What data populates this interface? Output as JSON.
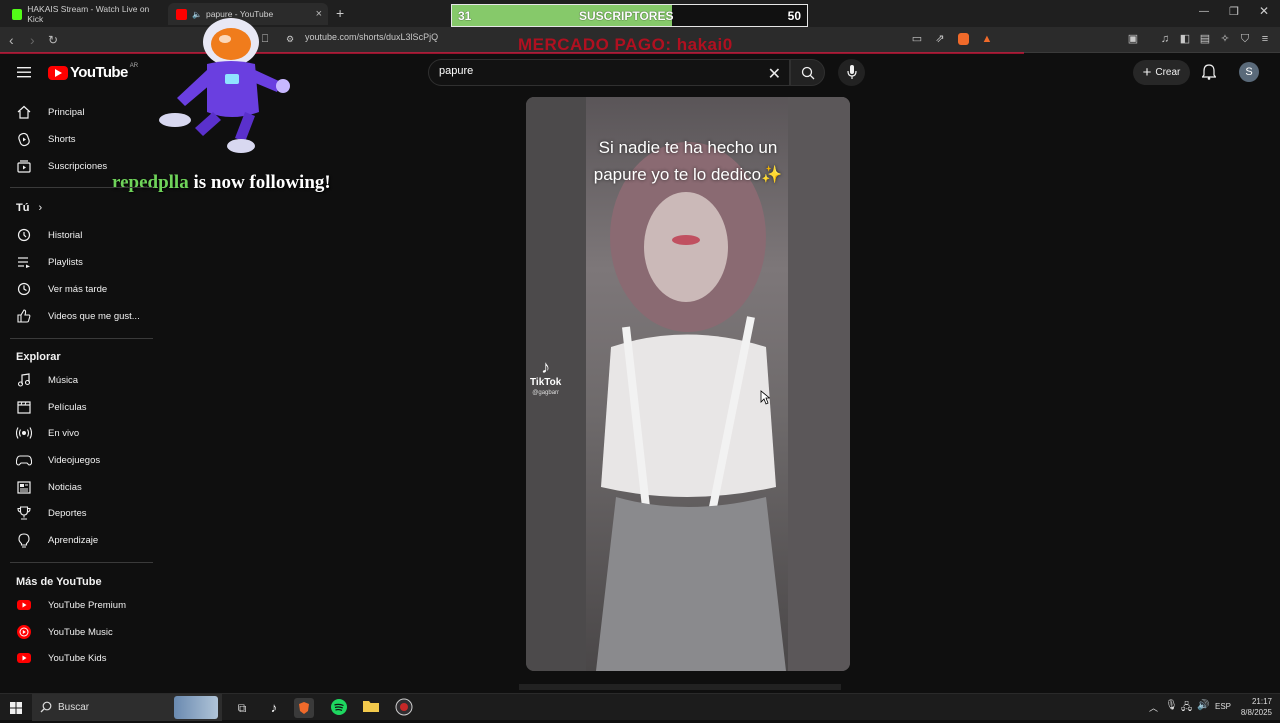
{
  "browser": {
    "tabs": [
      {
        "title": "HAKAIS Stream - Watch Live on Kick"
      },
      {
        "title": "papure - YouTube"
      }
    ],
    "url": "youtube.com/shorts/duxL3lScPjQ"
  },
  "overlay": {
    "sub_current": "31",
    "sub_label": "SUSCRIPTORES",
    "sub_goal": "50",
    "sub_progress": 0.62,
    "mercado": "MERCADO PAGO: hakai0",
    "follower_user": "repedplla",
    "follower_text": " is now following!"
  },
  "youtube": {
    "logo_text": "YouTube",
    "country_code": "AR",
    "search_value": "papure",
    "create_label": "Crear",
    "avatar_letter": "S",
    "sidebar": {
      "main": [
        "Principal",
        "Shorts",
        "Suscripciones"
      ],
      "you_heading": "Tú",
      "you_items": [
        "Historial",
        "Playlists",
        "Ver más tarde",
        "Videos que me gust..."
      ],
      "explore_heading": "Explorar",
      "explore_items": [
        "Música",
        "Películas",
        "En vivo",
        "Videojuegos",
        "Noticias",
        "Deportes",
        "Aprendizaje"
      ],
      "more_heading": "Más de YouTube",
      "more_items": [
        "YouTube Premium",
        "YouTube Music",
        "YouTube Kids"
      ]
    },
    "video": {
      "caption_line1": "Si nadie te ha hecho un",
      "caption_line2": "papure yo te lo dedico",
      "tiktok_label": "TikTok",
      "tiktok_user": "@gagbarr"
    }
  },
  "taskbar": {
    "search_label": "Buscar",
    "language": "ESP",
    "time": "21:17",
    "date": "8/8/2025"
  },
  "colors": {
    "accent_red": "#ff0000",
    "sub_fill": "#86c96a",
    "follower_green": "#6fd35a"
  }
}
